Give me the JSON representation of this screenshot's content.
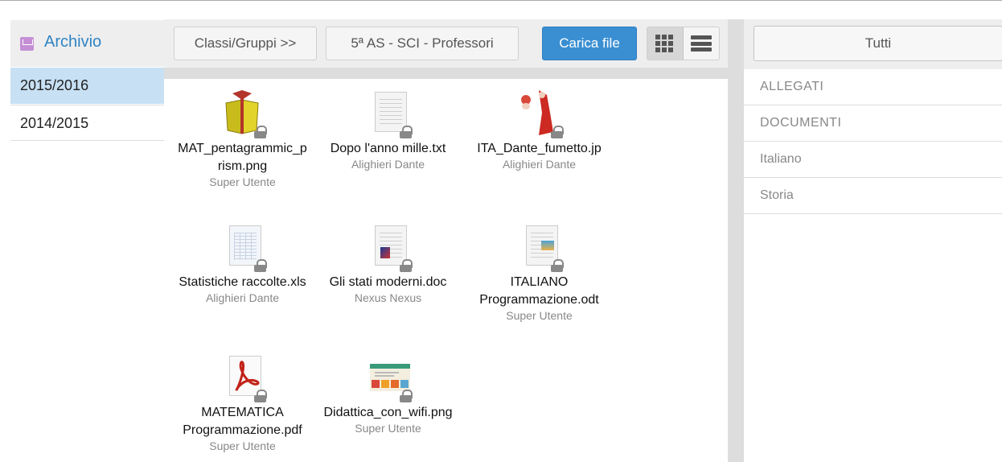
{
  "sidebar": {
    "title": "Archivio",
    "years": [
      {
        "label": "2015/2016",
        "active": true
      },
      {
        "label": "2014/2015",
        "active": false
      }
    ]
  },
  "toolbar": {
    "classi_label": "Classi/Gruppi >>",
    "class_label": "5ª AS - SCI - Professori",
    "upload_label": "Carica file",
    "view_mode": "grid"
  },
  "files": [
    {
      "name": "MAT_pentagrammic_p rism.png",
      "author": "Super Utente",
      "icon": "image-prism-icon"
    },
    {
      "name": "Dopo l'anno mille.txt",
      "author": "Alighieri Dante",
      "icon": "text-file-icon"
    },
    {
      "name": "ITA_Dante_fumetto.jp",
      "author": "Alighieri Dante",
      "icon": "image-dante-icon"
    },
    {
      "name": "Statistiche raccolte.xls",
      "author": "Alighieri Dante",
      "icon": "spreadsheet-icon"
    },
    {
      "name": "Gli stati moderni.doc",
      "author": "Nexus Nexus",
      "icon": "document-icon"
    },
    {
      "name": "ITALIANO Programmazione.odt",
      "author": "Super Utente",
      "icon": "odt-document-icon"
    },
    {
      "name": "MATEMATICA Programmazione.pdf",
      "author": "Super Utente",
      "icon": "pdf-icon"
    },
    {
      "name": "Didattica_con_wifi.png",
      "author": "Super Utente",
      "icon": "image-wifi-icon"
    }
  ],
  "filters": {
    "all_label": "Tutti",
    "items": [
      "ALLEGATI",
      "DOCUMENTI",
      "Italiano",
      "Storia"
    ]
  },
  "colors": {
    "accent": "#3a8fd3",
    "active_year_bg": "#c7e0f4",
    "title_link": "#2f84c4",
    "archive_icon": "#c58fd6"
  }
}
